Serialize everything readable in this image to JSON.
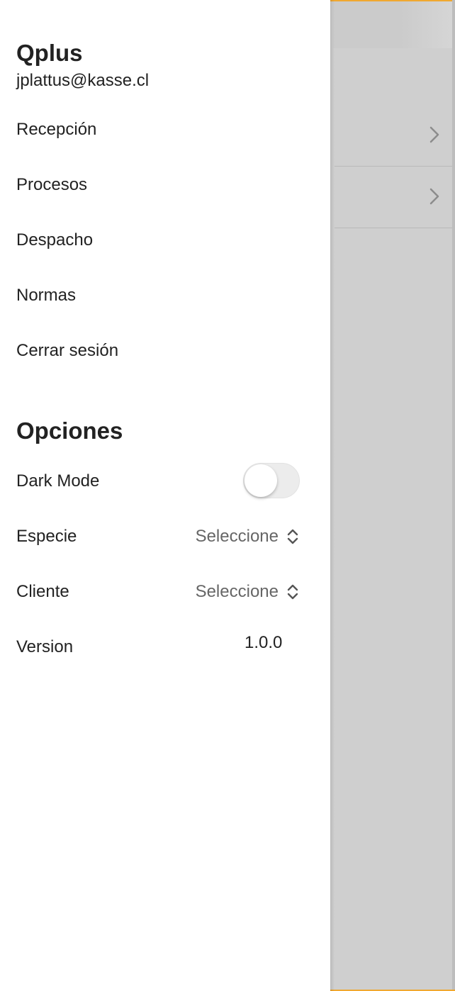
{
  "app": {
    "title": "Qplus",
    "user_email": "jplattus@kasse.cl"
  },
  "menu": {
    "items": [
      {
        "label": "Recepción"
      },
      {
        "label": "Procesos"
      },
      {
        "label": "Despacho"
      },
      {
        "label": "Normas"
      },
      {
        "label": "Cerrar sesión"
      }
    ]
  },
  "options": {
    "title": "Opciones",
    "dark_mode": {
      "label": "Dark Mode",
      "enabled": false
    },
    "especie": {
      "label": "Especie",
      "value": "Seleccione"
    },
    "cliente": {
      "label": "Cliente",
      "value": "Seleccione"
    },
    "version": {
      "label": "Version",
      "value": "1.0.0"
    }
  },
  "icons": {
    "row_chevron": "chevron-right-icon",
    "select_arrows": "chevron-up-down-icon"
  },
  "colors": {
    "accent": "#f0a830",
    "drawer_bg": "#ffffff",
    "backdrop": "#cfcfcf",
    "text": "#222222",
    "muted_text": "#666666"
  }
}
